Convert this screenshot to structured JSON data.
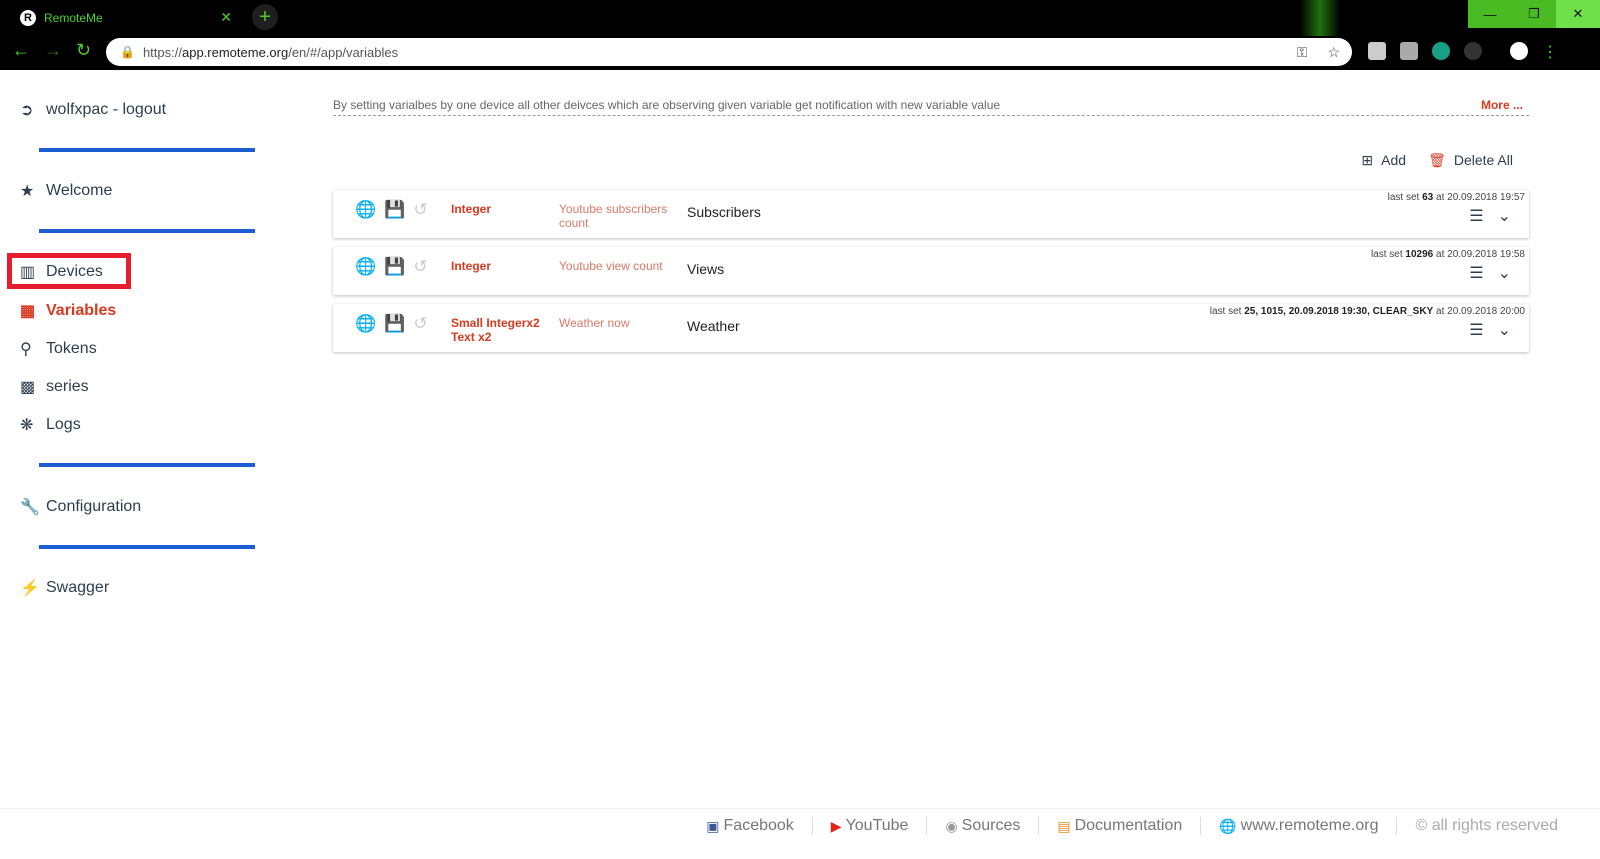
{
  "browser": {
    "tab_title": "RemoteMe",
    "tab_favicon": "R",
    "tab_close": "✕",
    "new_tab": "+",
    "url_prefix": "https://",
    "url_host": "app.remoteme.org",
    "url_path": "/en/#/app/variables",
    "win_minimize": "—",
    "win_restore": "❐",
    "win_close": "✕"
  },
  "sidebar": {
    "user": "wolfxpac - logout",
    "items": [
      {
        "label": "Welcome",
        "icon": "star-icon"
      },
      {
        "label": "Devices",
        "icon": "devices-icon"
      },
      {
        "label": "Variables",
        "icon": "variables-icon"
      },
      {
        "label": "Tokens",
        "icon": "key-icon"
      },
      {
        "label": "series",
        "icon": "chart-icon"
      },
      {
        "label": "Logs",
        "icon": "bug-icon"
      },
      {
        "label": "Configuration",
        "icon": "wrench-icon"
      },
      {
        "label": "Swagger",
        "icon": "plug-icon"
      }
    ]
  },
  "main": {
    "description": "By setting varialbes by one device all other deivces which are observing given variable get notification with new variable value",
    "more": "More ...",
    "add_label": "Add",
    "delete_all_label": "Delete All",
    "variables": [
      {
        "type": "Integer",
        "description": "Youtube subscribers count",
        "name": "Subscribers",
        "last_set_prefix": "last set",
        "last_value": "63",
        "last_time": "at 20.09.2018 19:57"
      },
      {
        "type": "Integer",
        "description": "Youtube view count",
        "name": "Views",
        "last_set_prefix": "last set",
        "last_value": "10296",
        "last_time": "at 20.09.2018 19:58"
      },
      {
        "type": "Small Integerx2 Text x2",
        "description": "Weather now",
        "name": "Weather",
        "last_set_prefix": "last set",
        "last_value": "25, 1015, 20.09.2018 19:30, CLEAR_SKY",
        "last_time": "at 20.09.2018 20:00"
      }
    ]
  },
  "footer": {
    "facebook": "Facebook",
    "youtube": "YouTube",
    "sources": "Sources",
    "documentation": "Documentation",
    "website": "www.remoteme.org",
    "rights": "© all rights reserved"
  },
  "colors": {
    "accent_red": "#d9391f",
    "separator_blue": "#1c5ed1",
    "browser_green": "#4cd12a"
  }
}
